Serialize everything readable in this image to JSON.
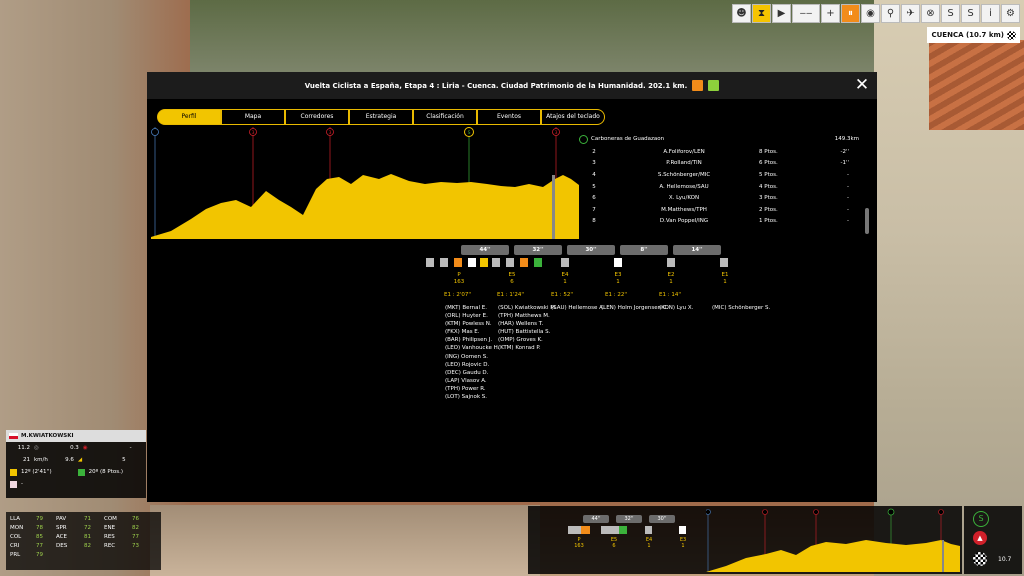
{
  "window": {
    "title": "Vuelta Ciclista a España, Etapa 4 : Liria - Cuenca. Ciudad Patrimonio de la Humanidad. 202.1 km.",
    "location": "CUENCA (10.7 km)"
  },
  "tabs": [
    "Perfil",
    "Mapa",
    "Corredores",
    "Estrategia",
    "Clasificación",
    "Eventos",
    "Atajos del teclado"
  ],
  "classification": {
    "title": "Carboneras de Guadazaon",
    "distance": "149.3km",
    "rows": [
      {
        "pos": "2",
        "name": "A.Foliforov/LEN",
        "pts": "8 Ptos.",
        "diff": "-2''"
      },
      {
        "pos": "3",
        "name": "P.Rolland/TIN",
        "pts": "6 Ptos.",
        "diff": "-1''"
      },
      {
        "pos": "4",
        "name": "S.Schönberger/MIC",
        "pts": "5 Ptos.",
        "diff": "-"
      },
      {
        "pos": "5",
        "name": "A. Hellemose/SAU",
        "pts": "4 Ptos.",
        "diff": "-"
      },
      {
        "pos": "6",
        "name": "X. Lyu/KON",
        "pts": "3 Ptos.",
        "diff": "-"
      },
      {
        "pos": "7",
        "name": "M.Matthews/TPH",
        "pts": "2 Ptos.",
        "diff": "-"
      },
      {
        "pos": "8",
        "name": "D.Van Poppel/ING",
        "pts": "1 Ptos.",
        "diff": "-"
      }
    ]
  },
  "gaps": [
    "44''",
    "32''",
    "30''",
    "8''",
    "14''"
  ],
  "groups": [
    {
      "label": "P",
      "count": "163",
      "time": "E1 : 2'07''"
    },
    {
      "label": "E5",
      "count": "6",
      "time": "E1 : 1'24''"
    },
    {
      "label": "E4",
      "count": "1",
      "time": "E1 : 52''"
    },
    {
      "label": "E3",
      "count": "1",
      "time": "E1 : 22''"
    },
    {
      "label": "E2",
      "count": "1",
      "time": "E1 : 14''"
    },
    {
      "label": "E1",
      "count": "1",
      "time": ""
    }
  ],
  "rider_lists": [
    "(MKT) Bernal E.\n(ORL) Huyter E.\n(KTM) Powless N.\n(FKX) Mas E.\n(BAR) Philipsen J.\n(LEO) Vanhoucke H.\n(ING) Oomen S.\n(LEO) Rojovic D.\n(DEC) Gaudu D.\n(LAP) Vlasov A.\n(TPH) Power R.\n(LOT) Sajnok S.",
    "(SOL) Kwiatkowski M.\n(TPH) Matthews M.\n(HAR) Wellens T.\n(HUT) Battistella S.\n(OMP) Groves K.\n(KTM) Konrad P.",
    "(SAU) Hellemose A.",
    "(LEN) Holm Jorgensen C.",
    "(KON) Lyu X.",
    "(MIC) Schönberger S."
  ],
  "rider": {
    "name": "M.KWIATKOWSKI",
    "val1": "11.2",
    "val2": "0.3",
    "val3": "-",
    "speed": "21",
    "speed_unit": "km/h",
    "grade": "9.6",
    "pos": "5",
    "gc": "12º (2'41'')",
    "points": "20º (8 Ptos.)",
    "extra": "-"
  },
  "stats": [
    [
      "LLA",
      "79",
      "PAV",
      "71",
      "COM",
      "76"
    ],
    [
      "MON",
      "78",
      "SPR",
      "72",
      "ENE",
      "82"
    ],
    [
      "COL",
      "85",
      "ACE",
      "81",
      "RES",
      "77"
    ],
    [
      "CRI",
      "77",
      "DES",
      "82",
      "REC",
      "73"
    ],
    [
      "PRL",
      "79",
      "",
      "",
      "",
      ""
    ]
  ],
  "mini": {
    "gaps": [
      "44''",
      "32''",
      "30''"
    ],
    "groups": [
      {
        "label": "P",
        "count": "163"
      },
      {
        "label": "E5",
        "count": "6"
      },
      {
        "label": "E4",
        "count": "1"
      },
      {
        "label": "E3",
        "count": "1"
      }
    ],
    "distance": "10.7"
  },
  "colors": {
    "accent": "#f2c500",
    "sprint": "#3bb23b",
    "kom": "#d0202a"
  }
}
